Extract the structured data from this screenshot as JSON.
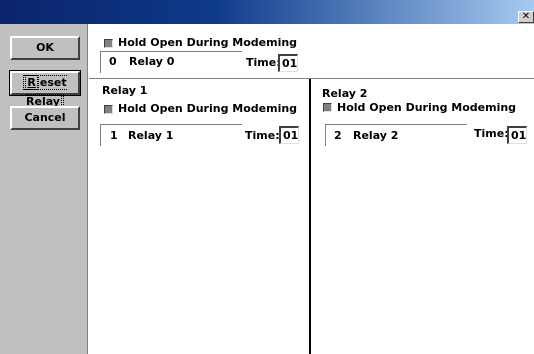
{
  "window": {
    "close_glyph": "✕"
  },
  "buttons": {
    "ok": "OK",
    "reset_first": "R",
    "reset_rest": "eset Relay",
    "cancel": "Cancel"
  },
  "relay0": {
    "hold_label": "Hold Open During Modeming",
    "number": "0",
    "name": "Relay 0",
    "time_label": "Time:",
    "time_value": "01"
  },
  "relay1": {
    "title": "Relay 1",
    "hold_label": "Hold Open During Modeming",
    "number": "1",
    "name": "Relay 1",
    "time_label": "Time:",
    "time_value": "01"
  },
  "relay2": {
    "title": "Relay 2",
    "hold_label": "Hold Open During Modeming",
    "number": "2",
    "name": "Relay 2",
    "time_label": "Time:",
    "time_value": "01"
  }
}
